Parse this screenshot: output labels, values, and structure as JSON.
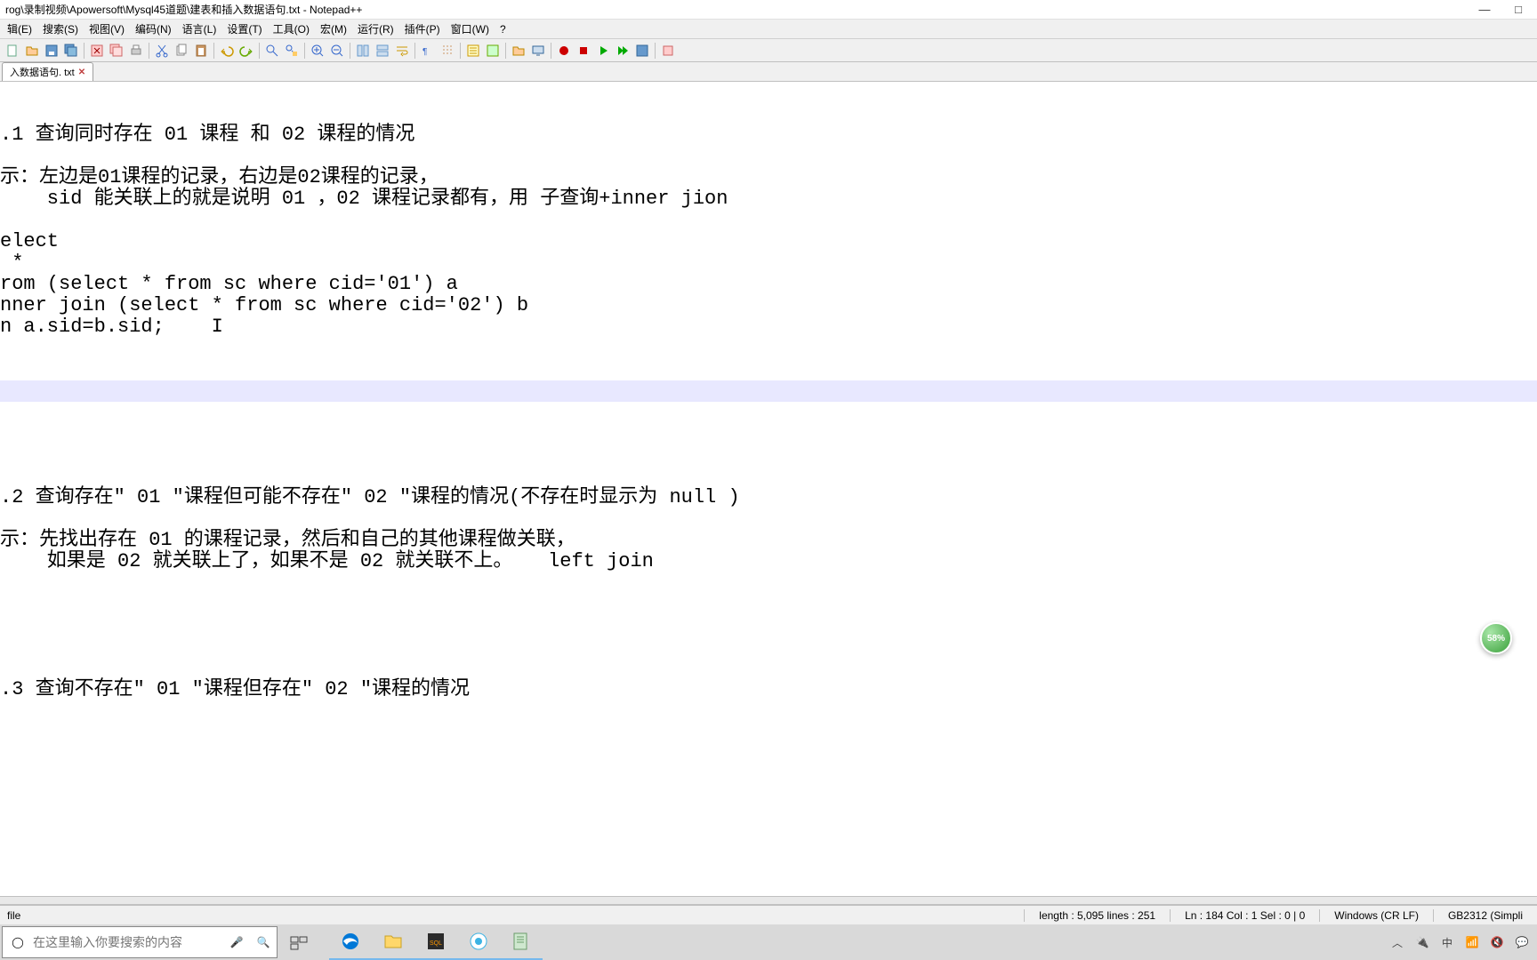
{
  "window": {
    "title": "rog\\录制视频\\Apowersoft\\Mysql45道题\\建表和插入数据语句.txt - Notepad++",
    "minimize": "—",
    "maximize": "□"
  },
  "menus": [
    "辑(E)",
    "搜索(S)",
    "视图(V)",
    "编码(N)",
    "语言(L)",
    "设置(T)",
    "工具(O)",
    "宏(M)",
    "运行(R)",
    "插件(P)",
    "窗口(W)",
    "?"
  ],
  "tab": {
    "label": "入数据语句. txt",
    "close": "✕"
  },
  "editor_lines": [
    "",
    "",
    ".1 查询同时存在 01 课程 和 02 课程的情况",
    "",
    "示：左边是01课程的记录，右边是02课程的记录，",
    "    sid 能关联上的就是说明 01 ，02 课程记录都有，用 子查询+inner jion",
    "",
    "elect",
    " *",
    "rom (select * from sc where cid='01') a",
    "nner join (select * from sc where cid='02') b",
    "n a.sid=b.sid;    I",
    "",
    "",
    "__HIGHLIGHT__",
    "",
    "",
    "",
    "",
    ".2 查询存在\" 01 \"课程但可能不存在\" 02 \"课程的情况(不存在时显示为 null )",
    "",
    "示：先找出存在 01 的课程记录，然后和自己的其他课程做关联，",
    "    如果是 02 就关联上了，如果不是 02 就关联不上。   left join",
    "",
    "",
    "",
    "",
    "",
    ".3 查询不存在\" 01 \"课程但存在\" 02 \"课程的情况",
    ""
  ],
  "status": {
    "left": "file",
    "length": "length : 5,095    lines : 251",
    "pos": "Ln : 184   Col : 1   Sel : 0 | 0",
    "eol": "Windows (CR LF)",
    "enc": "GB2312 (Simpli"
  },
  "search_placeholder": "在这里输入你要搜索的内容",
  "badge": "58%"
}
